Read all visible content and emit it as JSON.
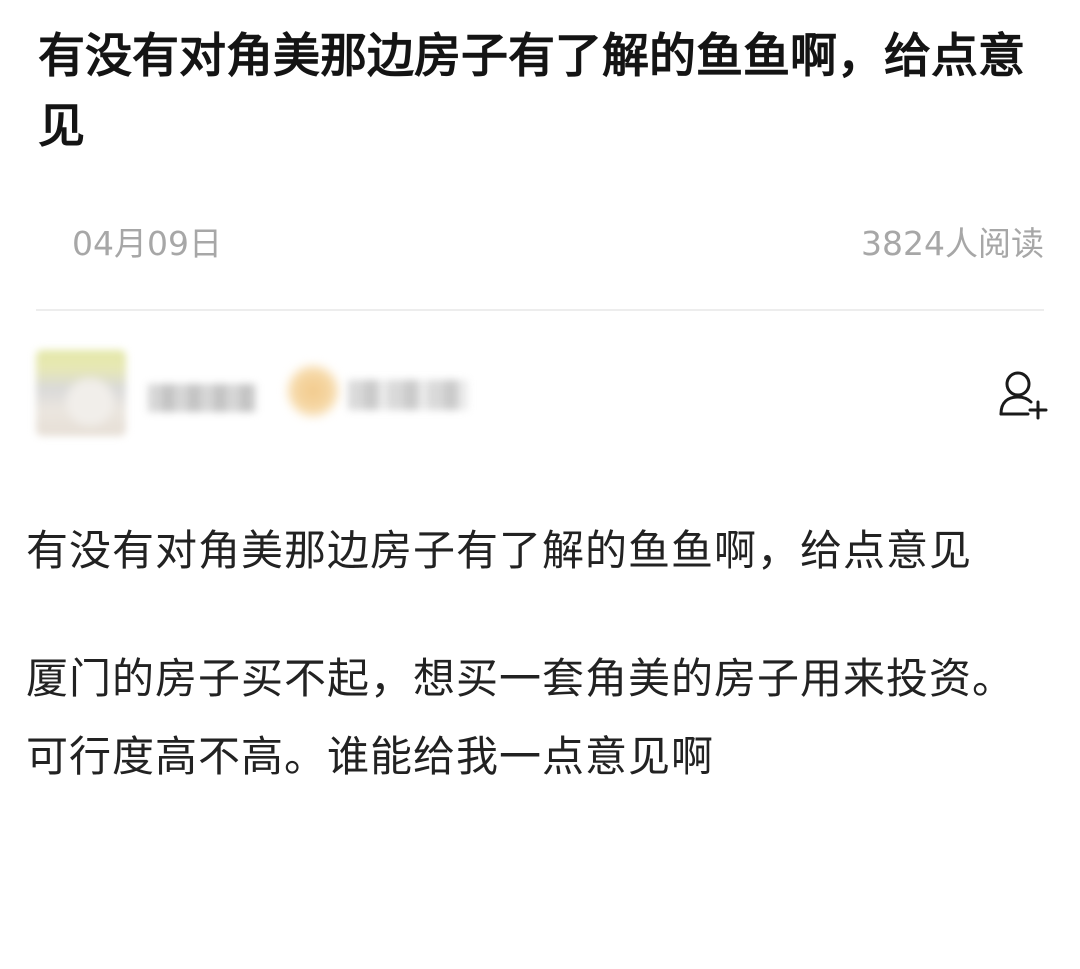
{
  "post": {
    "title": "有没有对角美那边房子有了解的鱼鱼啊，给点意见",
    "date": "04月09日",
    "views": "3824人阅读"
  },
  "author": {
    "avatar_icon": "user-avatar-blurred",
    "follow_icon": "add-user-icon"
  },
  "body": {
    "paragraphs": [
      "有没有对角美那边房子有了解的鱼鱼啊，给点意见",
      "厦门的房子买不起，想买一套角美的房子用来投资。可行度高不高。谁能给我一点意见啊"
    ]
  },
  "colors": {
    "title": "#141414",
    "meta": "#a7a7a7",
    "body": "#222222",
    "divider": "#ededed"
  }
}
